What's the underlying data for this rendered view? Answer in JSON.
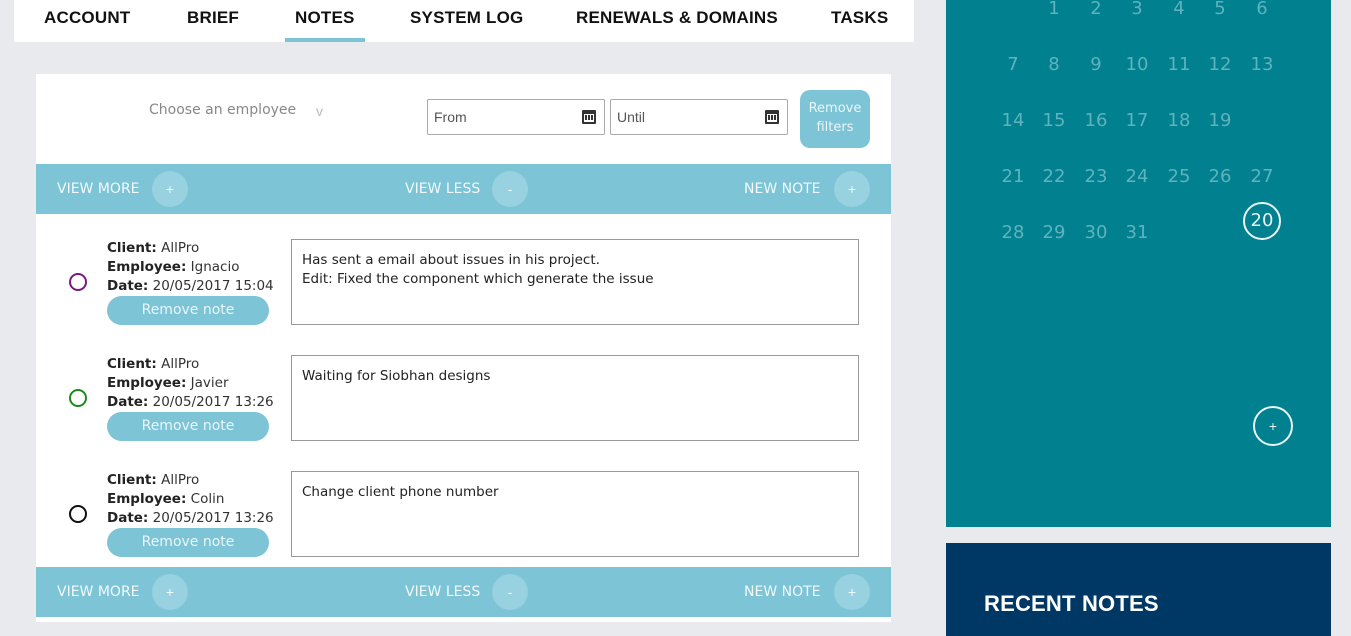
{
  "tabs": [
    {
      "label": "ACCOUNT"
    },
    {
      "label": "BRIEF"
    },
    {
      "label": "NOTES",
      "active": true
    },
    {
      "label": "SYSTEM LOG"
    },
    {
      "label": "RENEWALS & DOMAINS"
    },
    {
      "label": "TASKS"
    }
  ],
  "filters": {
    "employee_placeholder": "Choose an employee",
    "employee_chevron": "v",
    "from_placeholder": "From",
    "until_placeholder": "Until",
    "remove_filters": "Remove filters"
  },
  "actions": {
    "view_more": "VIEW MORE",
    "view_less": "VIEW LESS",
    "new_note": "NEW NOTE",
    "plus": "+",
    "minus": "-"
  },
  "labels": {
    "client": "Client:",
    "employee": "Employee:",
    "date": "Date:",
    "remove_note": "Remove note"
  },
  "notes": [
    {
      "client": "AllPro",
      "employee": "Ignacio",
      "date": "20/05/2017 15:04",
      "color": "#7a1a7a",
      "lines": [
        "Has sent a email about issues in his project.",
        "Edit: Fixed the component which generate the issue"
      ]
    },
    {
      "client": "AllPro",
      "employee": "Javier",
      "date": "20/05/2017 13:26",
      "color": "#1e8a1e",
      "lines": [
        "Waiting for Siobhan designs"
      ]
    },
    {
      "client": "AllPro",
      "employee": "Colin",
      "date": "20/05/2017 13:26",
      "color": "#111111",
      "lines": [
        "Change client phone number"
      ]
    }
  ],
  "calendar": {
    "weeks": [
      [
        "1",
        "2",
        "3",
        "4",
        "5",
        "6"
      ],
      [
        "7",
        "8",
        "9",
        "10",
        "11",
        "12",
        "13"
      ],
      [
        "14",
        "15",
        "16",
        "17",
        "18",
        "19",
        "20"
      ],
      [
        "21",
        "22",
        "23",
        "24",
        "25",
        "26",
        "27"
      ],
      [
        "28",
        "29",
        "30",
        "31"
      ]
    ],
    "today": "20",
    "add_label": "+"
  },
  "recent_notes": {
    "title": "RECENT NOTES"
  },
  "colors": {
    "accent": "#7cc4d6",
    "calendar_bg": "#01808f",
    "recent_bg": "#003865"
  }
}
